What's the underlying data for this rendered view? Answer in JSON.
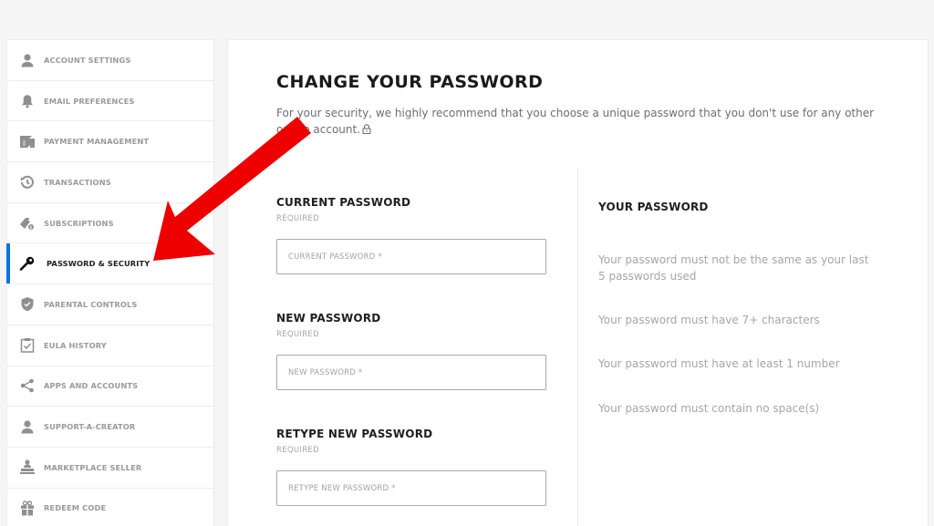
{
  "sidebar": {
    "items": [
      {
        "label": "ACCOUNT SETTINGS",
        "icon": "person-icon",
        "active": false
      },
      {
        "label": "EMAIL PREFERENCES",
        "icon": "bell-icon",
        "active": false
      },
      {
        "label": "PAYMENT MANAGEMENT",
        "icon": "wallet-icon",
        "active": false
      },
      {
        "label": "TRANSACTIONS",
        "icon": "history-icon",
        "active": false
      },
      {
        "label": "SUBSCRIPTIONS",
        "icon": "subscription-icon",
        "active": false
      },
      {
        "label": "PASSWORD & SECURITY",
        "icon": "key-icon",
        "active": true
      },
      {
        "label": "PARENTAL CONTROLS",
        "icon": "shield-icon",
        "active": false
      },
      {
        "label": "EULA HISTORY",
        "icon": "clipboard-check-icon",
        "active": false
      },
      {
        "label": "APPS AND ACCOUNTS",
        "icon": "share-icon",
        "active": false
      },
      {
        "label": "SUPPORT-A-CREATOR",
        "icon": "person-icon",
        "active": false
      },
      {
        "label": "MARKETPLACE SELLER",
        "icon": "seller-icon",
        "active": false
      },
      {
        "label": "REDEEM CODE",
        "icon": "gift-icon",
        "active": false
      }
    ],
    "active_color": "#0074e4"
  },
  "main": {
    "title": "CHANGE YOUR PASSWORD",
    "intro": "For your security, we highly recommend that you choose a unique password that you don't use for any other online account.",
    "lock_glyph": "🔓",
    "fields": [
      {
        "label": "CURRENT PASSWORD",
        "required": "REQUIRED",
        "placeholder": "CURRENT PASSWORD *",
        "value": ""
      },
      {
        "label": "NEW PASSWORD",
        "required": "REQUIRED",
        "placeholder": "NEW PASSWORD *",
        "value": ""
      },
      {
        "label": "RETYPE NEW PASSWORD",
        "required": "REQUIRED",
        "placeholder": "RETYPE NEW PASSWORD *",
        "value": ""
      }
    ],
    "rules": {
      "title": "YOUR PASSWORD",
      "items": [
        "Your password must not be the same as your last 5 passwords used",
        "Your password must have 7+ characters",
        "Your password must have at least 1 number",
        "Your password must contain no space(s)"
      ]
    }
  },
  "annotation": {
    "type": "arrow",
    "color": "#ee0000",
    "points_to": "PASSWORD & SECURITY"
  }
}
